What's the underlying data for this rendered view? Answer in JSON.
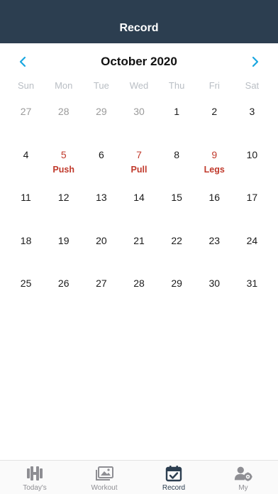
{
  "header": {
    "title": "Record"
  },
  "calendar": {
    "month_title": "October 2020",
    "weekdays": [
      "Sun",
      "Mon",
      "Tue",
      "Wed",
      "Thu",
      "Fri",
      "Sat"
    ],
    "days": [
      {
        "n": "27",
        "other": true
      },
      {
        "n": "28",
        "other": true
      },
      {
        "n": "29",
        "other": true
      },
      {
        "n": "30",
        "other": true
      },
      {
        "n": "1"
      },
      {
        "n": "2"
      },
      {
        "n": "3"
      },
      {
        "n": "4"
      },
      {
        "n": "5",
        "label": "Push"
      },
      {
        "n": "6"
      },
      {
        "n": "7",
        "label": "Pull"
      },
      {
        "n": "8"
      },
      {
        "n": "9",
        "label": "Legs"
      },
      {
        "n": "10"
      },
      {
        "n": "11"
      },
      {
        "n": "12"
      },
      {
        "n": "13"
      },
      {
        "n": "14"
      },
      {
        "n": "15"
      },
      {
        "n": "16"
      },
      {
        "n": "17"
      },
      {
        "n": "18"
      },
      {
        "n": "19"
      },
      {
        "n": "20"
      },
      {
        "n": "21"
      },
      {
        "n": "22"
      },
      {
        "n": "23"
      },
      {
        "n": "24"
      },
      {
        "n": "25"
      },
      {
        "n": "26"
      },
      {
        "n": "27"
      },
      {
        "n": "28"
      },
      {
        "n": "29"
      },
      {
        "n": "30"
      },
      {
        "n": "31"
      }
    ]
  },
  "tabs": [
    {
      "label": "Today's",
      "icon": "dumbbell-icon",
      "active": false
    },
    {
      "label": "Workout",
      "icon": "photos-icon",
      "active": false
    },
    {
      "label": "Record",
      "icon": "calendar-check-icon",
      "active": true
    },
    {
      "label": "My",
      "icon": "user-settings-icon",
      "active": false
    }
  ],
  "colors": {
    "header_bg": "#2c3e50",
    "accent_arrow": "#1aa7e0",
    "workout_red": "#c0392b",
    "tab_active": "#2c3e50",
    "tab_inactive": "#8e8e93"
  }
}
